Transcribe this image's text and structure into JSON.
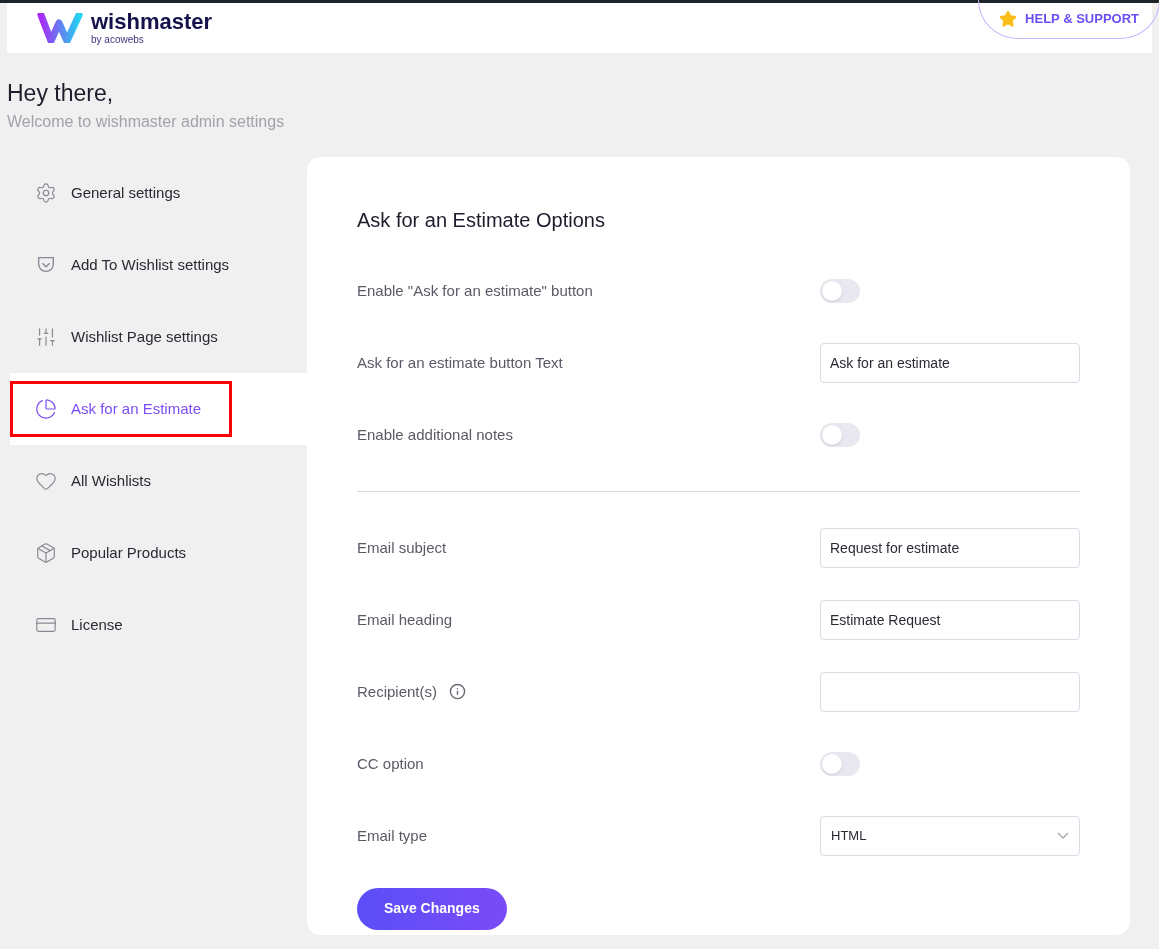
{
  "header": {
    "logo": "wishmaster",
    "logo_sub": "by acowebs",
    "help_button": "HELP & SUPPORT"
  },
  "greeting": {
    "title": "Hey there,",
    "subtitle": "Welcome to wishmaster admin settings"
  },
  "sidebar": {
    "items": [
      {
        "label": "General settings",
        "selected": false
      },
      {
        "label": "Add To Wishlist settings",
        "selected": false
      },
      {
        "label": "Wishlist Page settings",
        "selected": false
      },
      {
        "label": "Ask for an Estimate",
        "selected": true
      },
      {
        "label": "All Wishlists",
        "selected": false
      },
      {
        "label": "Popular Products",
        "selected": false
      },
      {
        "label": "License",
        "selected": false
      }
    ]
  },
  "panel": {
    "title": "Ask for an Estimate Options",
    "rows": [
      {
        "kind": "toggle",
        "label": "Enable \"Ask for an estimate\" button",
        "on": false
      },
      {
        "kind": "text",
        "label": "Ask for an estimate button Text",
        "value": "Ask for an estimate"
      },
      {
        "kind": "toggle",
        "label": "Enable additional notes",
        "on": false
      },
      {
        "kind": "divider"
      },
      {
        "kind": "text",
        "label": "Email subject",
        "value": "Request for estimate"
      },
      {
        "kind": "text",
        "label": "Email heading",
        "value": "Estimate Request"
      },
      {
        "kind": "text",
        "label": "Recipient(s)",
        "info": true
      },
      {
        "kind": "toggle",
        "label": "CC option",
        "on": false
      },
      {
        "kind": "select",
        "label": "Email type",
        "value": "HTML"
      }
    ],
    "save_button": "Save Changes"
  }
}
